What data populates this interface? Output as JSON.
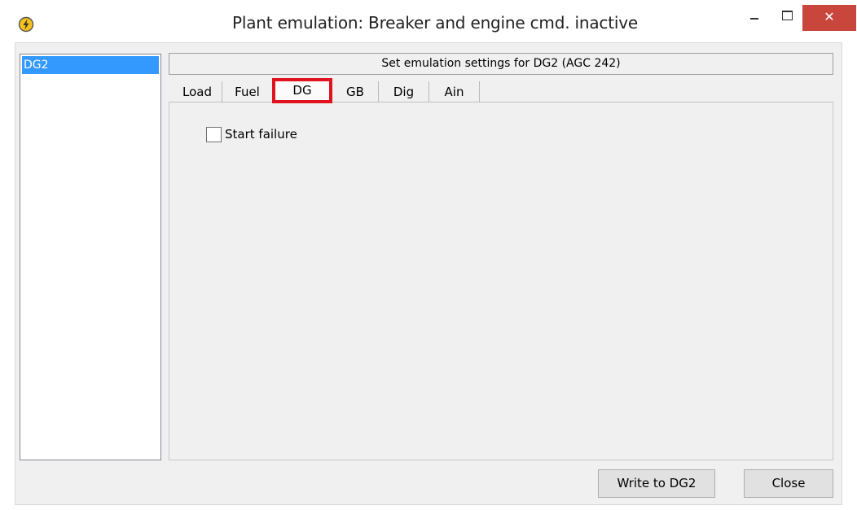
{
  "window": {
    "title": "Plant emulation: Breaker and engine cmd. inactive",
    "app_icon": "lightning-icon",
    "close_glyph": "✕"
  },
  "sidebar": {
    "items": [
      {
        "label": "DG2",
        "selected": true
      }
    ]
  },
  "header": {
    "label": "Set emulation settings for DG2 (AGC 242)"
  },
  "tabs": [
    {
      "label": "Load"
    },
    {
      "label": "Fuel"
    },
    {
      "label": "DG",
      "active": true
    },
    {
      "label": "GB"
    },
    {
      "label": "Dig"
    },
    {
      "label": "Ain"
    }
  ],
  "panel": {
    "start_failure": {
      "label": "Start failure",
      "checked": false
    }
  },
  "buttons": {
    "write_label": "Write to DG2",
    "close_label": "Close"
  },
  "colors": {
    "selection": "#3399ff",
    "highlight_box": "#e0141e",
    "close_button": "#c9463d"
  }
}
